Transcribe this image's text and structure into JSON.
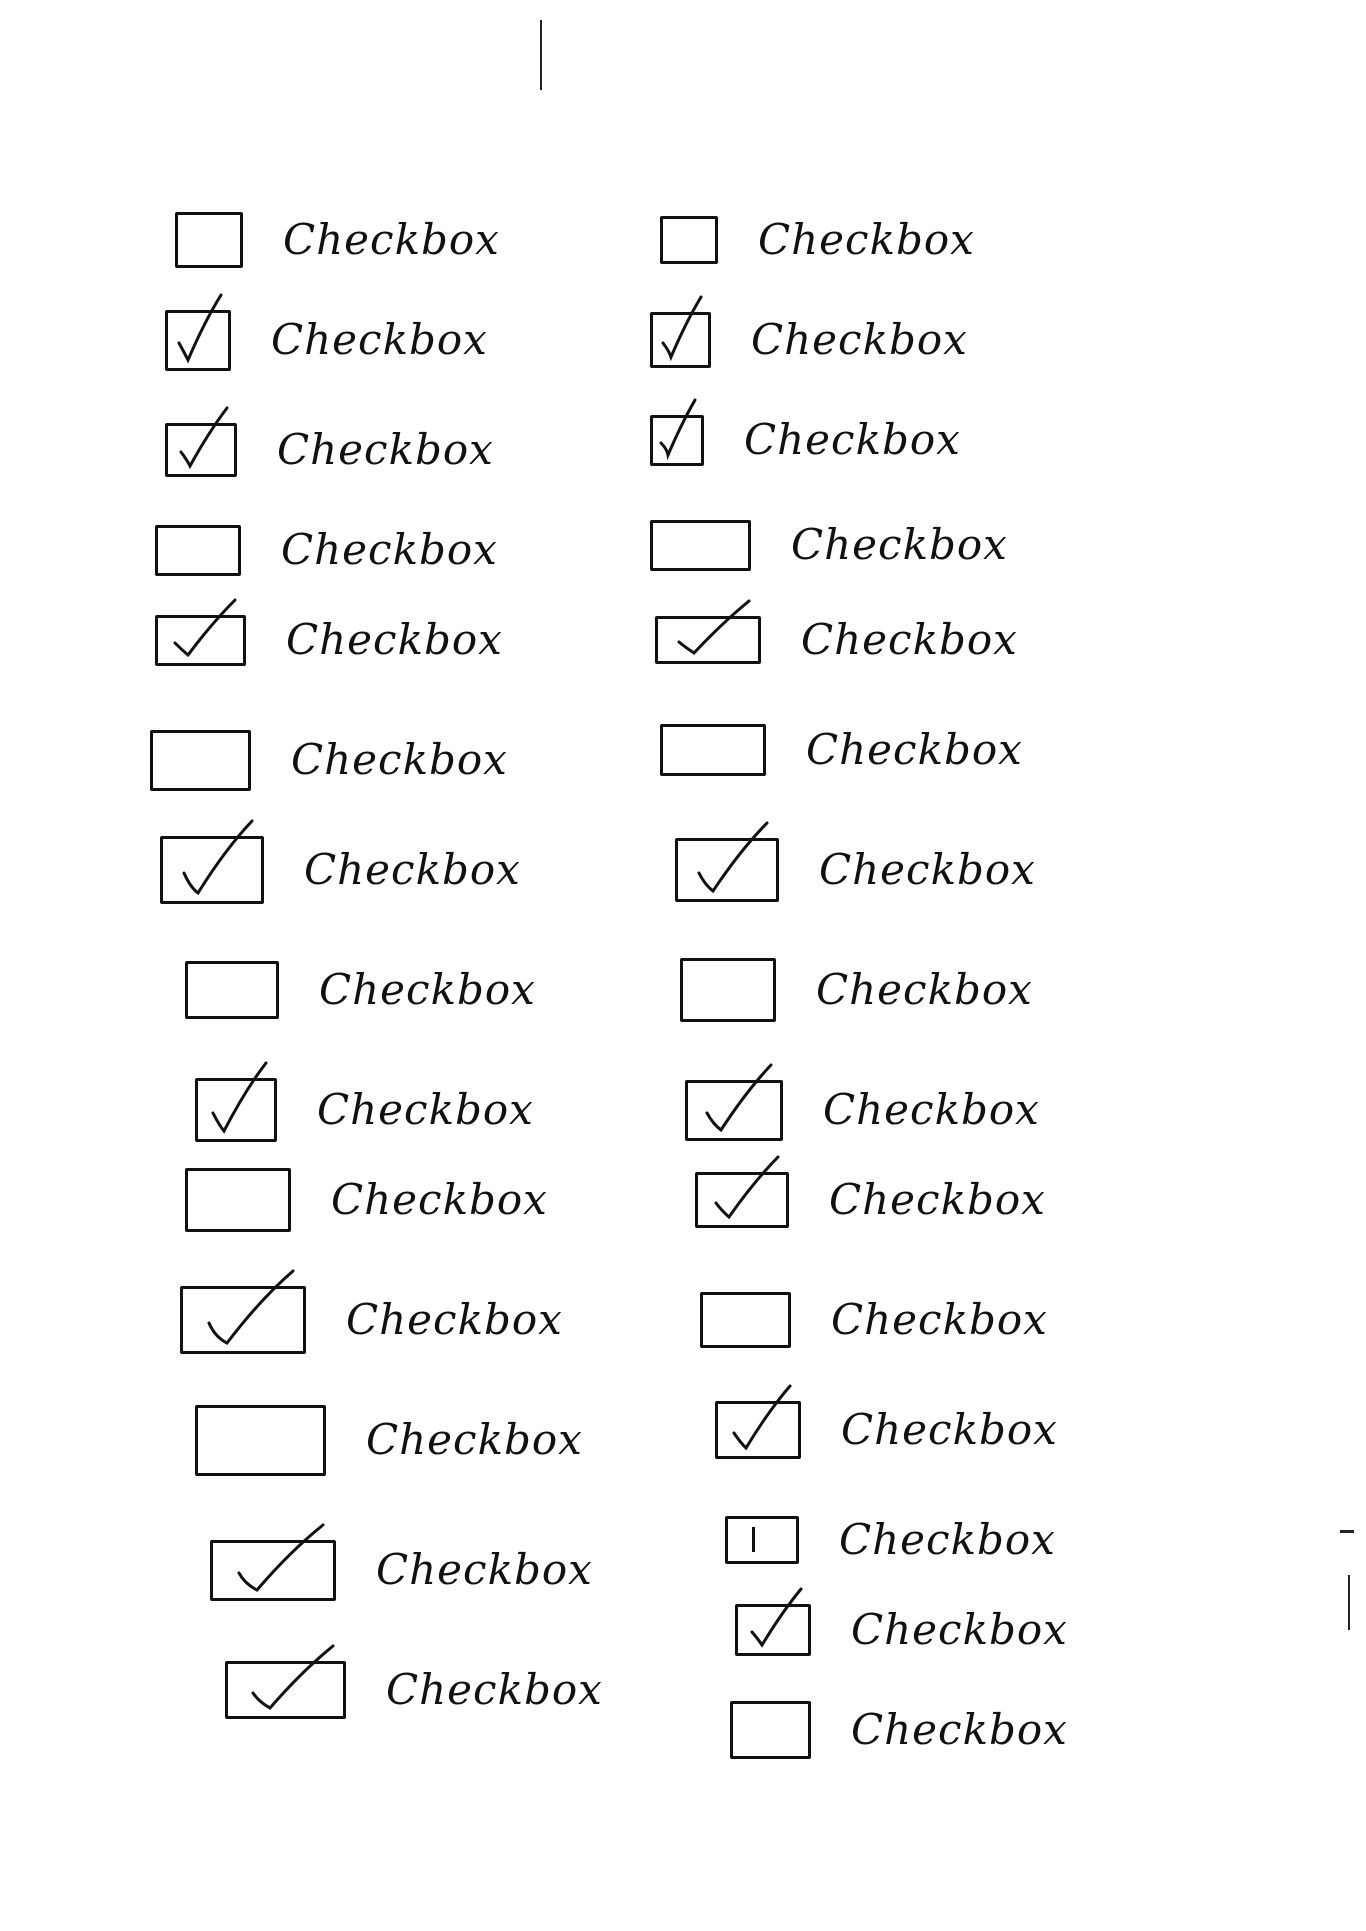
{
  "form": {
    "left_column": [
      {
        "label": "Checkbox",
        "state": "unchecked"
      },
      {
        "label": "Checkbox",
        "state": "checked"
      },
      {
        "label": "Checkbox",
        "state": "checked"
      },
      {
        "label": "Checkbox",
        "state": "unchecked"
      },
      {
        "label": "Checkbox",
        "state": "checked"
      },
      {
        "label": "Checkbox",
        "state": "unchecked"
      },
      {
        "label": "Checkbox",
        "state": "checked"
      },
      {
        "label": "Checkbox",
        "state": "unchecked"
      },
      {
        "label": "Checkbox",
        "state": "checked"
      },
      {
        "label": "Checkbox",
        "state": "unchecked"
      },
      {
        "label": "Checkbox",
        "state": "checked"
      },
      {
        "label": "Checkbox",
        "state": "unchecked"
      },
      {
        "label": "Checkbox",
        "state": "checked"
      },
      {
        "label": "Checkbox",
        "state": "checked"
      }
    ],
    "right_column": [
      {
        "label": "Checkbox",
        "state": "unchecked"
      },
      {
        "label": "Checkbox",
        "state": "checked"
      },
      {
        "label": "Checkbox",
        "state": "checked"
      },
      {
        "label": "Checkbox",
        "state": "unchecked"
      },
      {
        "label": "Checkbox",
        "state": "checked"
      },
      {
        "label": "Checkbox",
        "state": "unchecked"
      },
      {
        "label": "Checkbox",
        "state": "checked"
      },
      {
        "label": "Checkbox",
        "state": "unchecked"
      },
      {
        "label": "Checkbox",
        "state": "checked"
      },
      {
        "label": "Checkbox",
        "state": "checked"
      },
      {
        "label": "Checkbox",
        "state": "unchecked"
      },
      {
        "label": "Checkbox",
        "state": "checked"
      },
      {
        "label": "Checkbox",
        "state": "indeterminate"
      },
      {
        "label": "Checkbox",
        "state": "checked"
      },
      {
        "label": "Checkbox",
        "state": "unchecked"
      }
    ]
  },
  "colors": {
    "ink": "#111111",
    "paper": "#ffffff"
  }
}
